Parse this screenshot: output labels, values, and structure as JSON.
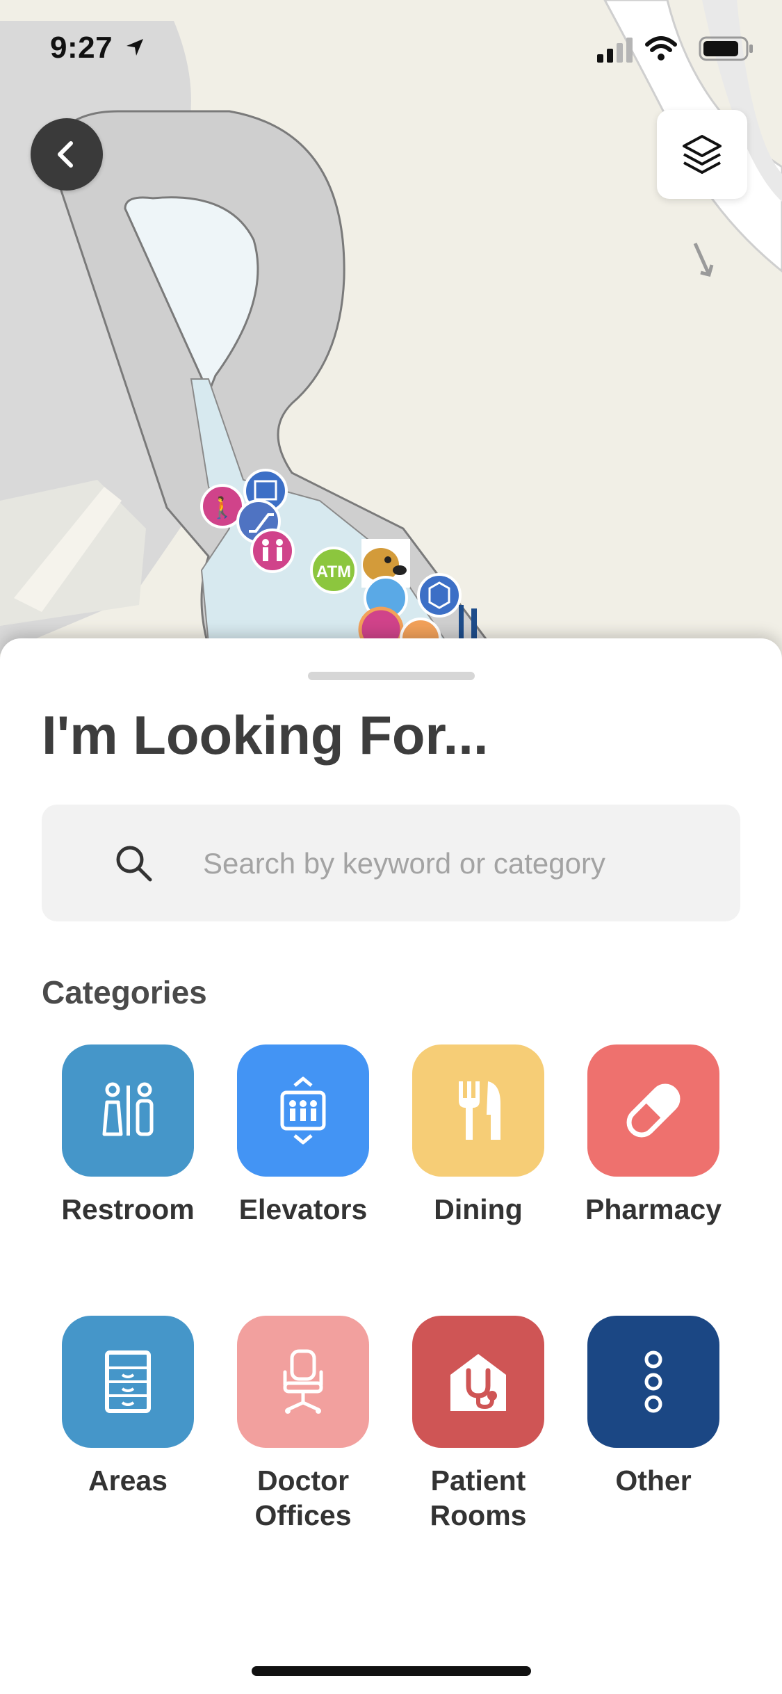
{
  "status": {
    "time": "9:27"
  },
  "map": {
    "poi_atm_label": "ATM"
  },
  "sheet": {
    "title": "I'm Looking For...",
    "search": {
      "placeholder": "Search by keyword or category",
      "value": ""
    },
    "categories_heading": "Categories",
    "categories": [
      {
        "label": "Restroom",
        "icon": "restroom-icon",
        "color": "#4596c9"
      },
      {
        "label": "Elevators",
        "icon": "elevator-icon",
        "color": "#4394f4"
      },
      {
        "label": "Dining",
        "icon": "dining-icon",
        "color": "#f6cd76"
      },
      {
        "label": "Pharmacy",
        "icon": "pill-icon",
        "color": "#ee716e"
      },
      {
        "label": "Areas",
        "icon": "cabinet-icon",
        "color": "#4596c9"
      },
      {
        "label": "Doctor Offices",
        "icon": "office-chair-icon",
        "color": "#f2a09e"
      },
      {
        "label": "Patient Rooms",
        "icon": "stethoscope-house-icon",
        "color": "#cf5555"
      },
      {
        "label": "Other",
        "icon": "more-dots-icon",
        "color": "#1b4784"
      }
    ]
  }
}
